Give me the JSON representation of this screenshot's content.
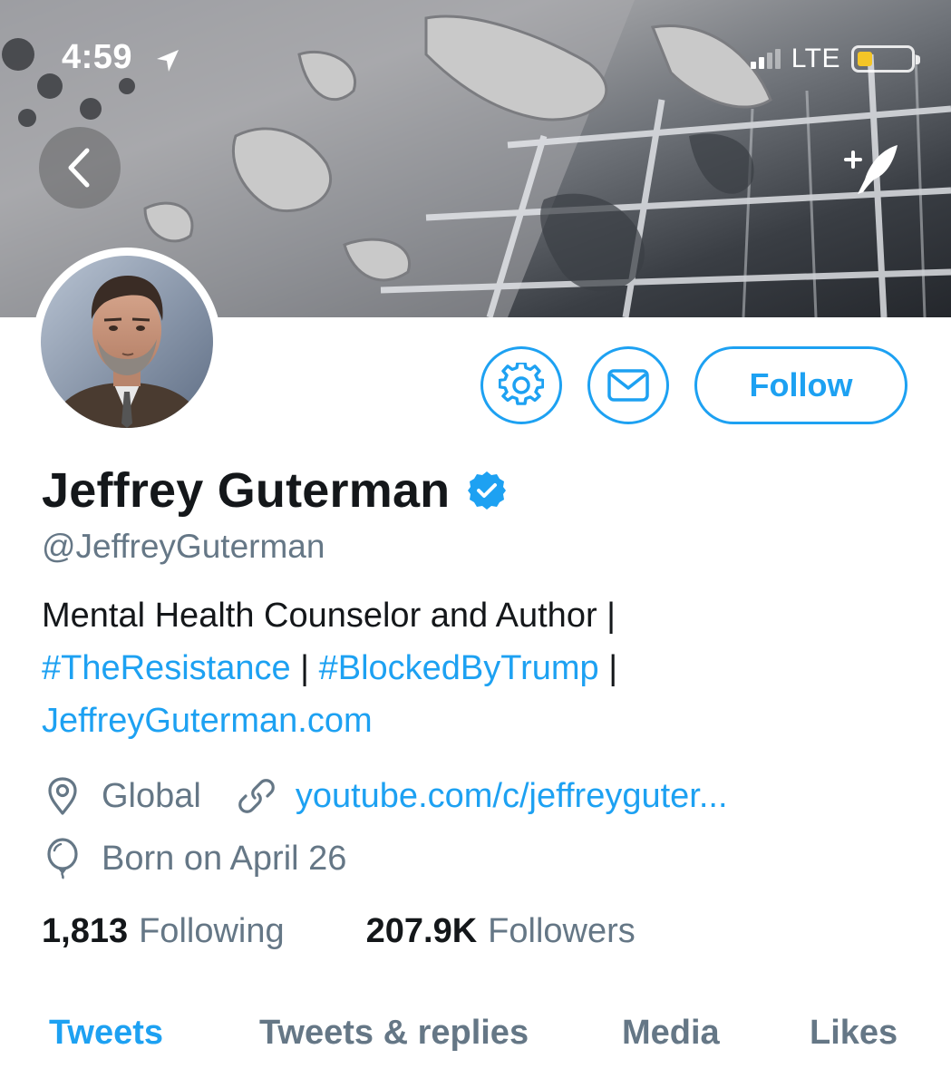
{
  "status_bar": {
    "time": "4:59",
    "network": "LTE",
    "battery_color": "#f4c527"
  },
  "header": {
    "back_icon": "chevron-left-icon",
    "compose_icon": "compose-tweet-icon"
  },
  "actions": {
    "settings_icon": "gear-icon",
    "message_icon": "envelope-icon",
    "follow_label": "Follow"
  },
  "profile": {
    "name": "Jeffrey Guterman",
    "verified": true,
    "handle": "@JeffreyGuterman",
    "bio": {
      "line1": "Mental Health Counselor and Author |",
      "hashtag1": "#TheResistance",
      "sep1": " | ",
      "hashtag2": "#BlockedByTrump",
      "sep2": " |",
      "website": "JeffreyGuterman.com"
    },
    "location": "Global",
    "url": "youtube.com/c/jeffreyguter...",
    "birthday": "Born on April 26"
  },
  "stats": {
    "following_count": "1,813",
    "following_label": "Following",
    "followers_count": "207.9K",
    "followers_label": "Followers"
  },
  "tabs": [
    {
      "label": "Tweets",
      "active": true
    },
    {
      "label": "Tweets & replies",
      "active": false
    },
    {
      "label": "Media",
      "active": false
    },
    {
      "label": "Likes",
      "active": false
    }
  ],
  "colors": {
    "accent": "#1da1f2",
    "secondary_text": "#657786",
    "primary_text": "#14171a"
  }
}
